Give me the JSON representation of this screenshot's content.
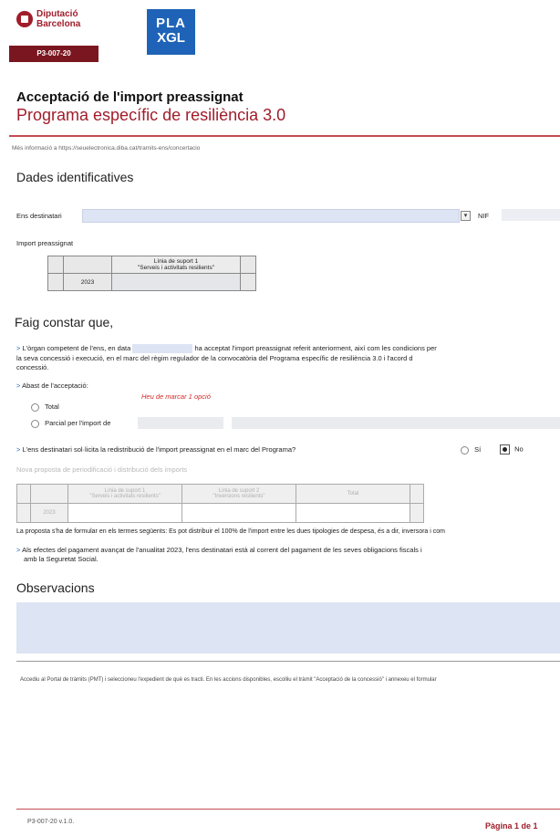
{
  "header": {
    "org_line1": "Diputació",
    "org_line2": "Barcelona",
    "form_code": "P3-007-20",
    "pla_line1": "PLA",
    "pla_line2": "XGL"
  },
  "title": "Acceptació de l'import preassignat",
  "subtitle": "Programa específic de resiliència 3.0",
  "more_info": "Més informació a https://seuelectronica.diba.cat/tramits-ens/concertacio",
  "section_ident": {
    "heading": "Dades identificatives",
    "ens_label": "Ens destinatari",
    "nif_label": "NIF",
    "import_label": "Import preassignat",
    "table": {
      "col_header_line1": "Línia de suport 1",
      "col_header_line2": "\"Serveis i activitats resilients\"",
      "row_label": "2023"
    }
  },
  "section_faig": {
    "heading": "Faig constar que,",
    "p1_prefix": "L'òrgan competent de l'ens, en data",
    "p1_mid": "ha acceptat l'import preassignat referit anteriorment, així com les condicions per",
    "p1_line2": "la seva concessió i execució, en el marc del règim regulador de la convocatòria del Programa específic de resiliència 3.0 i l'acord d",
    "p1_line3": "concessió.",
    "abast_label": "Abast de l'acceptació:",
    "abast_error": "Heu de marcar 1 opció",
    "opt_total": "Total",
    "opt_parcial": "Parcial per l'import de",
    "redis_q": "L'ens destinatari sol·licita la redistribució de l'import preassignat en el marc del Programa?",
    "opt_si": "Sí",
    "opt_no": "No",
    "nova_proposta": "Nova proposta de periodificació i distribució dels imports",
    "table2": {
      "col1_line1": "Línia de suport 1",
      "col1_line2": "\"Serveis i activitats resilients\"",
      "col2_line1": "Línia de suport 2",
      "col2_line2": "\"Inversions resilients\"",
      "col3": "Total",
      "row_label": "2023"
    },
    "proposta_note": "La proposta s'ha de formular en els termes següents: Es pot distribuir el 100% de l'import entre les dues tipologies de despesa, és a dir, inversora i com",
    "pagament_line1": "Als efectes del pagament avançat de l'anualitat 2023, l'ens destinatari està al corrent del pagament de les seves obligacions fiscals i",
    "pagament_line2": "amb la Seguretat Social."
  },
  "section_obs": {
    "heading": "Observacions"
  },
  "footer_note": "Accediu al Portal de tràmits (PMT) i seleccioneu l'expedient de què es tracti. En les accions disponibles, escolliu el tràmit \"Acceptació de la concessió\" i annexeu el formular",
  "footer": {
    "version": "P3-007-20 v.1.0.",
    "page": "Pàgina 1 de 1"
  },
  "colors": {
    "brand_red": "#a01d2b",
    "pla_blue": "#1f63b8",
    "field_blue": "#dde4f3"
  }
}
